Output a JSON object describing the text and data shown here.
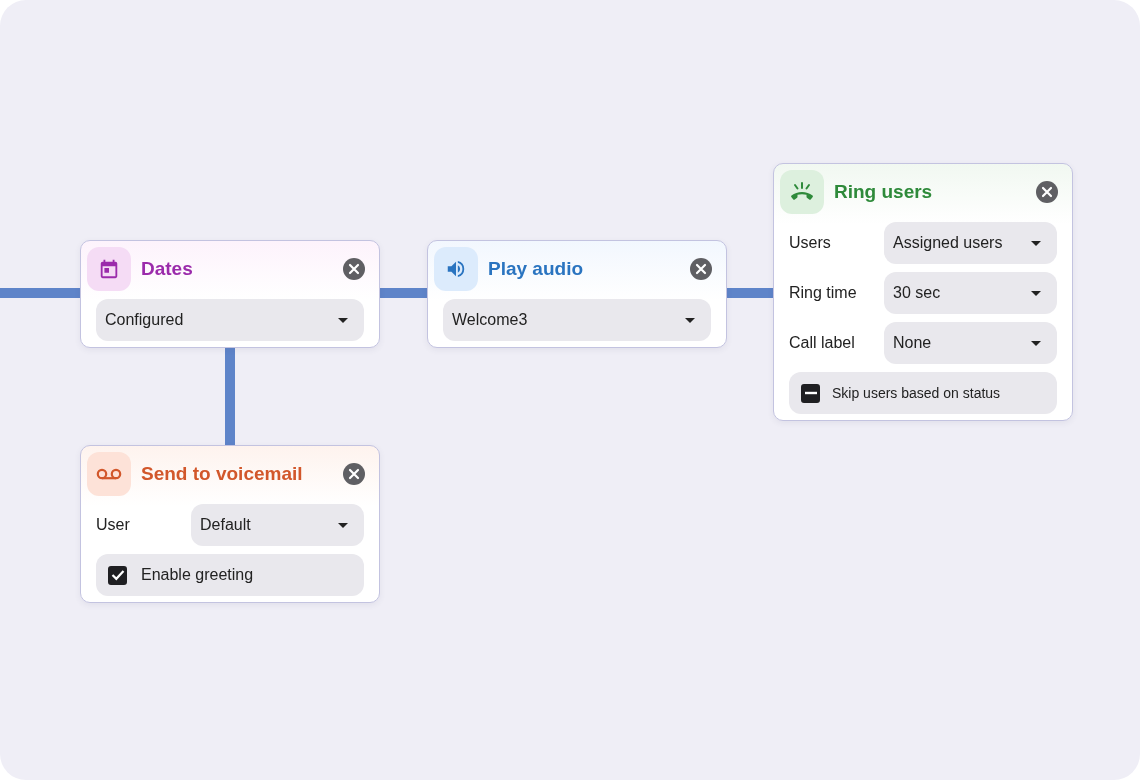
{
  "nodes": [
    {
      "kind": "dates",
      "title": "Dates",
      "fields": [
        {
          "kind": "select",
          "value": "Configured"
        }
      ]
    },
    {
      "kind": "audio",
      "title": "Play audio",
      "fields": [
        {
          "kind": "select",
          "value": "Welcome3"
        }
      ]
    },
    {
      "kind": "ring",
      "title": "Ring users",
      "fields": [
        {
          "kind": "select",
          "label": "Users",
          "value": "Assigned users"
        },
        {
          "kind": "select",
          "label": "Ring time",
          "value": "30 sec"
        },
        {
          "kind": "select",
          "label": "Call label",
          "value": "None"
        },
        {
          "kind": "checkbox",
          "label": "Skip users based on status",
          "checked": false,
          "indeterminate": true
        }
      ]
    },
    {
      "kind": "voicemail",
      "title": "Send to voicemail",
      "fields": [
        {
          "kind": "select",
          "label": "User",
          "value": "Default"
        },
        {
          "kind": "checkbox",
          "label": "Enable greeting",
          "checked": true,
          "indeterminate": false
        }
      ]
    }
  ]
}
